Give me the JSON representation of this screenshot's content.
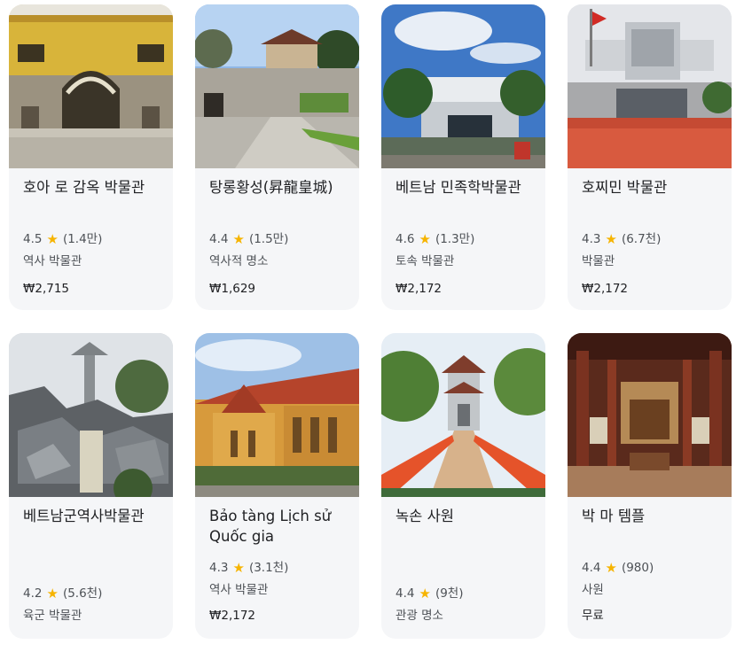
{
  "cards": [
    {
      "title": "호아 로 감옥 박물관",
      "rating": "4.5",
      "reviews": "(1.4만)",
      "category": "역사 박물관",
      "price": "₩2,715",
      "image": "hoa-lo-prison-photo"
    },
    {
      "title": "탕롱황성(昇龍皇城)",
      "rating": "4.4",
      "reviews": "(1.5만)",
      "category": "역사적 명소",
      "price": "₩1,629",
      "image": "thang-long-citadel-photo"
    },
    {
      "title": "베트남 민족학박물관",
      "rating": "4.6",
      "reviews": "(1.3만)",
      "category": "토속 박물관",
      "price": "₩2,172",
      "image": "ethnology-museum-photo"
    },
    {
      "title": "호찌민 박물관",
      "rating": "4.3",
      "reviews": "(6.7천)",
      "category": "박물관",
      "price": "₩2,172",
      "image": "ho-chi-minh-museum-photo"
    },
    {
      "title": "베트남군역사박물관",
      "rating": "4.2",
      "reviews": "(5.6천)",
      "category": "육군 박물관",
      "price": "",
      "image": "military-history-museum-photo"
    },
    {
      "title": "Bảo tàng Lịch sử Quốc gia",
      "rating": "4.3",
      "reviews": "(3.1천)",
      "category": "역사 박물관",
      "price": "₩2,172",
      "image": "national-history-museum-photo"
    },
    {
      "title": "녹손 사원",
      "rating": "4.4",
      "reviews": "(9천)",
      "category": "관광 명소",
      "price": "",
      "image": "ngoc-son-temple-photo"
    },
    {
      "title": "박 마 템플",
      "rating": "4.4",
      "reviews": "(980)",
      "category": "사원",
      "price": "무료",
      "image": "bach-ma-temple-photo"
    }
  ],
  "star_icon": "★",
  "colors": {
    "star": "#f6b400",
    "card_bg": "#f5f6f8",
    "text": "#202124",
    "secondary": "#4d5156"
  }
}
